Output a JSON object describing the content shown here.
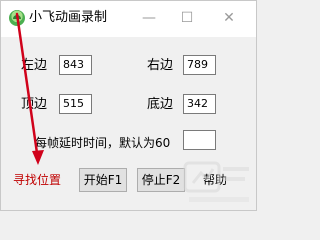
{
  "window": {
    "title": "小飞动画录制",
    "controls": {
      "minimize": "—",
      "maximize": "☐",
      "close": "✕"
    }
  },
  "fields": {
    "left": {
      "label": "左边",
      "value": "843"
    },
    "right": {
      "label": "右边",
      "value": "789"
    },
    "top": {
      "label": "顶边",
      "value": "515"
    },
    "bottom": {
      "label": "底边",
      "value": "342"
    },
    "frame_delay": {
      "label": "每帧延时时间，默认为60",
      "value": ""
    }
  },
  "buttons": {
    "find_position": "寻找位置",
    "start": "开始F1",
    "stop": "停止F2",
    "help": "帮助"
  },
  "colors": {
    "annotation_arrow": "#d0021b",
    "find_position_text": "#c00000"
  }
}
